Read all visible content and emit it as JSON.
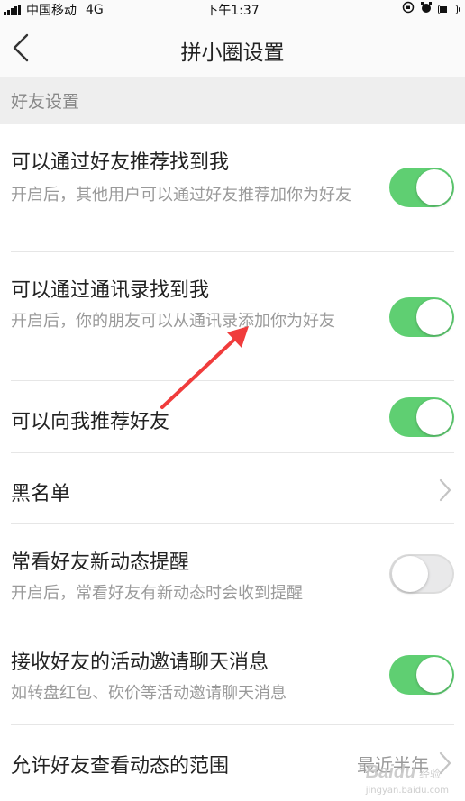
{
  "status_bar": {
    "carrier": "中国移动",
    "network": "4G",
    "time": "下午1:37"
  },
  "header": {
    "title": "拼小圈设置",
    "back_icon": "chevron-left-icon"
  },
  "section": {
    "title": "好友设置"
  },
  "settings": [
    {
      "label": "可以通过好友推荐找到我",
      "description": "开启后，其他用户可以通过好友推荐加你为好友",
      "control": "toggle",
      "on": true
    },
    {
      "label": "可以通过通讯录找到我",
      "description": "开启后，你的朋友可以从通讯录添加你为好友",
      "control": "toggle",
      "on": true
    },
    {
      "label": "可以向我推荐好友",
      "control": "toggle",
      "on": true
    },
    {
      "label": "黑名单",
      "control": "chevron"
    },
    {
      "label": "常看好友新动态提醒",
      "description": "开启后，常看好友有新动态时会收到提醒",
      "control": "toggle",
      "on": false
    },
    {
      "label": "接收好友的活动邀请聊天消息",
      "description": "如转盘红包、砍价等活动邀请聊天消息",
      "control": "toggle",
      "on": true
    },
    {
      "label": "允许好友查看动态的范围",
      "value": "最近半年",
      "control": "chevron"
    }
  ],
  "colors": {
    "toggle_on": "#5fcf72",
    "toggle_off": "#e9e9ea",
    "annotation_arrow": "#f03c3c"
  },
  "watermark": {
    "brand": "Baidu",
    "suffix": "经验",
    "domain": "jingyan.baidu.com"
  }
}
